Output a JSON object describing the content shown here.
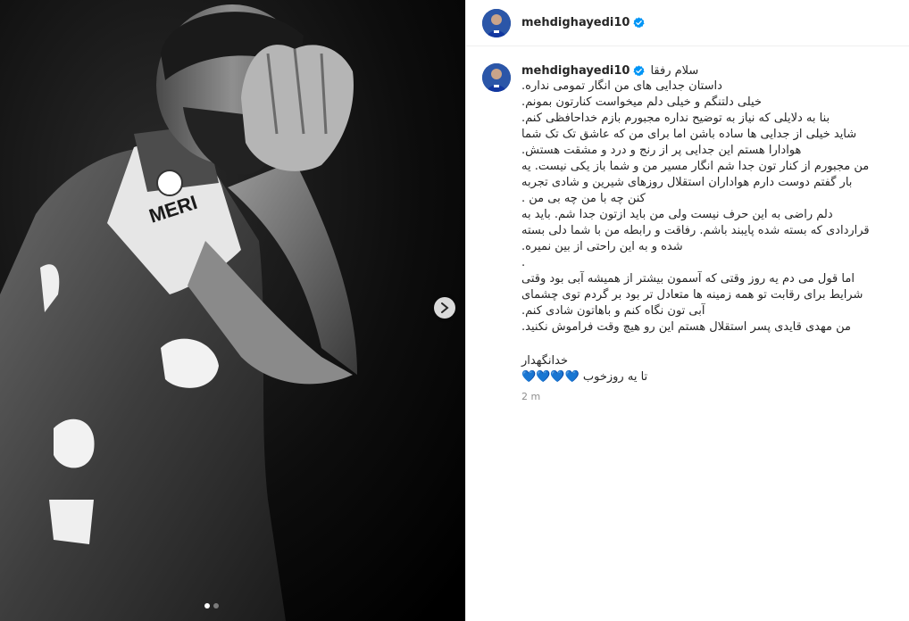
{
  "post": {
    "username": "mehdighayedi10",
    "verified_icon": "verified-badge-icon",
    "caption_first": "سلام رفقا",
    "caption_lines": [
      "داستان جدایی های من انگار تمومی نداره.",
      "خیلی دلتنگم و خیلی دلم میخواست کنارتون بمونم.",
      "بنا به دلایلی که نیاز به توضیح نداره مجبورم بازم خداحافظی کنم.",
      "شاید خیلی از جدایی ها ساده باشن اما برای من که عاشق تک تک شما",
      "هوادارا هستم این جدایی پر از رنج و درد و مشقت هستش.",
      "من مجبورم از کنار تون جدا شم انگار مسیر من و شما باز یکی نیست. یه",
      "بار گفتم دوست دارم هواداران استقلال روزهای شیرین و شادی تجربه",
      "کنن چه با من چه بی من .",
      "دلم راضی به این حرف نیست ولی من باید ازتون جدا شم. باید به",
      "قراردادی که بسته شده پایبند باشم. رفاقت و رابطه من با شما دلی بسته",
      "شده و به این راحتی از بین نمیره.",
      ".",
      "اما قول می دم یه روز وقتی که آسمون بیشتر از همیشه آبی بود وقتی",
      "شرایط برای رقابت تو همه زمینه ها متعادل تر بود بر گردم توی چشمای",
      "آبی تون نگاه کنم و باهاتون شادی کنم.",
      "من مهدی قایدی پسر استقلال هستم این رو هیچ وقت فراموش نکنید."
    ],
    "sign_off": "خدانگهدار",
    "last_line_text": "تا یه روزخوب",
    "hearts": "💙💙💙💙",
    "time": "2 m",
    "accent_color": "#0095f6",
    "heart_color": "#0a5ac2"
  },
  "media": {
    "jersey_text": "MERI",
    "next_icon": "chevron-right-icon",
    "slide_count": 2,
    "active_slide": 1
  }
}
